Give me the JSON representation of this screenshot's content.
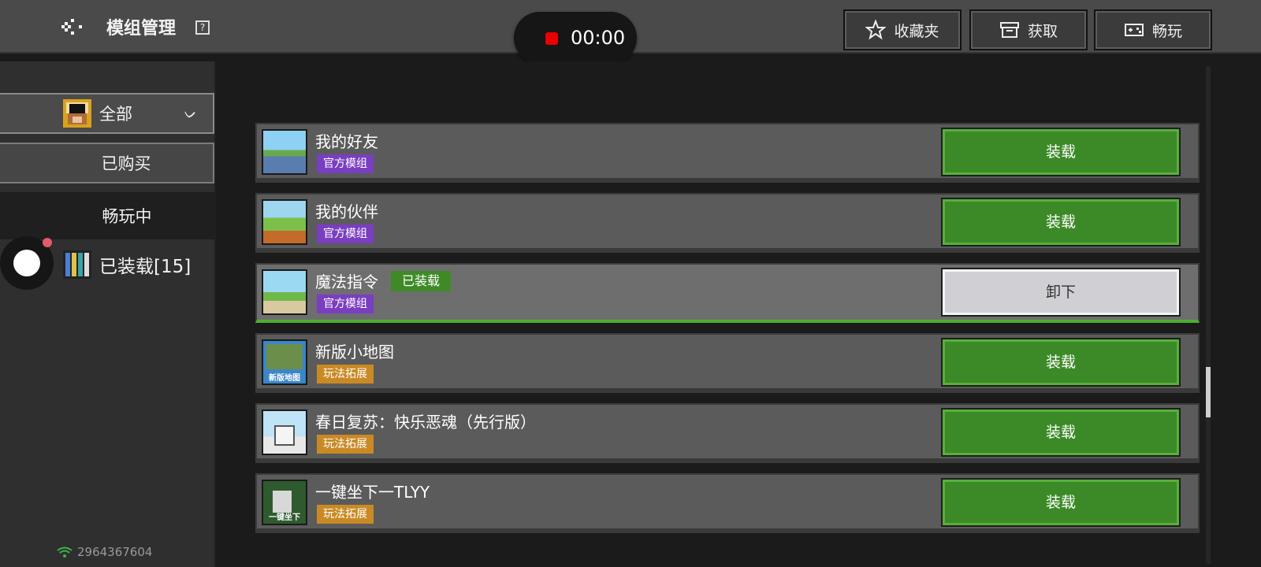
{
  "header": {
    "title": "模组管理",
    "help_icon": "help-icon",
    "recording_time": "00:00",
    "buttons": [
      {
        "label": "收藏夹",
        "icon": "star-icon"
      },
      {
        "label": "获取",
        "icon": "archive-icon"
      },
      {
        "label": "畅玩",
        "icon": "gamepad-icon"
      }
    ]
  },
  "sidebar": {
    "categories": [
      {
        "label": "全部",
        "icon": "all-category-icon",
        "expanded": true
      },
      {
        "label": "已购买"
      },
      {
        "label": "畅玩中"
      }
    ],
    "installed_label": "已装载[15]",
    "user_id": "2964367604"
  },
  "mods": [
    {
      "name": "我的好友",
      "tag": "官方模组",
      "tag_type": "official",
      "button": "装载",
      "installed": false
    },
    {
      "name": "我的伙伴",
      "tag": "官方模组",
      "tag_type": "official",
      "button": "装载",
      "installed": false
    },
    {
      "name": "魔法指令",
      "tag": "官方模组",
      "tag_type": "official",
      "button": "卸下",
      "installed": true,
      "installed_badge": "已装载"
    },
    {
      "name": "新版小地图",
      "tag": "玩法拓展",
      "tag_type": "play",
      "button": "装载",
      "installed": false,
      "thumb_text": "新版地图"
    },
    {
      "name": "春日复苏：快乐恶魂（先行版）",
      "tag": "玩法拓展",
      "tag_type": "play",
      "button": "装载",
      "installed": false
    },
    {
      "name": "一键坐下一TLYY",
      "tag": "玩法拓展",
      "tag_type": "play",
      "button": "装载",
      "installed": false,
      "thumb_text": "一键坐下"
    }
  ],
  "colors": {
    "load_green": "#3c8a27",
    "official_purple": "#7a3ec0",
    "play_orange": "#c98a26",
    "record_red": "#e80000"
  }
}
